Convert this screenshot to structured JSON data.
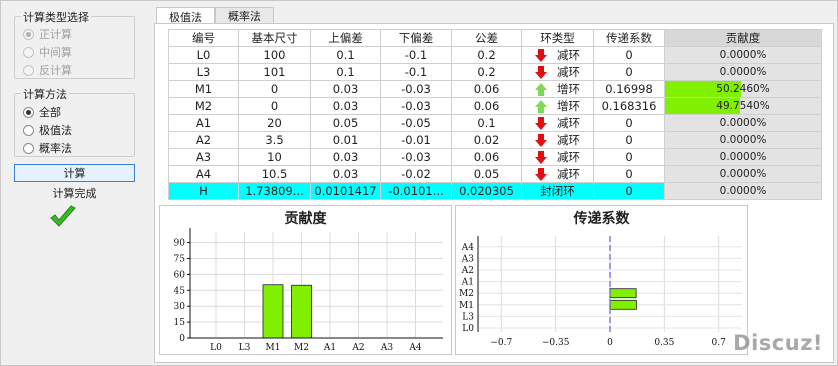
{
  "left_panel": {
    "calc_type": {
      "title": "计算类型选择",
      "options": [
        "正计算",
        "中间算",
        "反计算"
      ]
    },
    "calc_method": {
      "title": "计算方法",
      "options": [
        "全部",
        "极值法",
        "概率法"
      ]
    },
    "calc_button": "计算",
    "status_text": "计算完成"
  },
  "tabs": [
    "极值法",
    "概率法"
  ],
  "table": {
    "headers": [
      "编号",
      "基本尺寸",
      "上偏差",
      "下偏差",
      "公差",
      "环类型",
      "传递系数",
      "贡献度"
    ],
    "rows": [
      {
        "id": "L0",
        "nominal": "100",
        "upper": "0.1",
        "lower": "-0.1",
        "tol": "0.2",
        "arrow": "down",
        "type": "减环",
        "coef": "0",
        "contrib": "0.0000%",
        "pct": 0
      },
      {
        "id": "L3",
        "nominal": "101",
        "upper": "0.1",
        "lower": "-0.1",
        "tol": "0.2",
        "arrow": "down",
        "type": "减环",
        "coef": "0",
        "contrib": "0.0000%",
        "pct": 0
      },
      {
        "id": "M1",
        "nominal": "0",
        "upper": "0.03",
        "lower": "-0.03",
        "tol": "0.06",
        "arrow": "up",
        "type": "增环",
        "coef": "0.16998",
        "contrib": "50.2460%",
        "pct": 50.246
      },
      {
        "id": "M2",
        "nominal": "0",
        "upper": "0.03",
        "lower": "-0.03",
        "tol": "0.06",
        "arrow": "up",
        "type": "增环",
        "coef": "0.168316",
        "contrib": "49.7540%",
        "pct": 49.754
      },
      {
        "id": "A1",
        "nominal": "20",
        "upper": "0.05",
        "lower": "-0.05",
        "tol": "0.1",
        "arrow": "down",
        "type": "减环",
        "coef": "0",
        "contrib": "0.0000%",
        "pct": 0
      },
      {
        "id": "A2",
        "nominal": "3.5",
        "upper": "0.01",
        "lower": "-0.01",
        "tol": "0.02",
        "arrow": "down",
        "type": "减环",
        "coef": "0",
        "contrib": "0.0000%",
        "pct": 0
      },
      {
        "id": "A3",
        "nominal": "10",
        "upper": "0.03",
        "lower": "-0.03",
        "tol": "0.06",
        "arrow": "down",
        "type": "减环",
        "coef": "0",
        "contrib": "0.0000%",
        "pct": 0
      },
      {
        "id": "A4",
        "nominal": "10.5",
        "upper": "0.03",
        "lower": "-0.02",
        "tol": "0.05",
        "arrow": "down",
        "type": "减环",
        "coef": "0",
        "contrib": "0.0000%",
        "pct": 0
      }
    ],
    "closed_row": {
      "id": "H",
      "nominal": "1.73809...",
      "upper": "0.0101417",
      "lower": "-0.0101...",
      "tol": "0.020305",
      "type": "封闭环",
      "coef": "0",
      "contrib": "0.0000%"
    }
  },
  "colors": {
    "bar_fill": "#80f000",
    "closed_row": "#00ffff",
    "arrow_down": "#e01010",
    "arrow_up": "#7ed957",
    "zero_line": "#6a6ae0"
  },
  "chart_data": [
    {
      "type": "bar",
      "title": "贡献度",
      "categories": [
        "L0",
        "L3",
        "M1",
        "M2",
        "A1",
        "A2",
        "A3",
        "A4"
      ],
      "values": [
        0,
        0,
        50.246,
        49.754,
        0,
        0,
        0,
        0
      ],
      "ylim": [
        0,
        100
      ],
      "yticks": [
        "0",
        "15",
        "30",
        "45",
        "60",
        "75",
        "90"
      ],
      "grid": true
    },
    {
      "type": "bar",
      "orientation": "horizontal",
      "title": "传递系数",
      "categories": [
        "L0",
        "L3",
        "M1",
        "M2",
        "A1",
        "A2",
        "A3",
        "A4"
      ],
      "values": [
        0,
        0,
        0.16998,
        0.168316,
        0,
        0,
        0,
        0
      ],
      "xlim": [
        -0.85,
        0.85
      ],
      "xticks": [
        "−0.7",
        "−0.35",
        "0",
        "0.35",
        "0.7"
      ],
      "grid": true
    }
  ],
  "watermark": "Discuz!"
}
